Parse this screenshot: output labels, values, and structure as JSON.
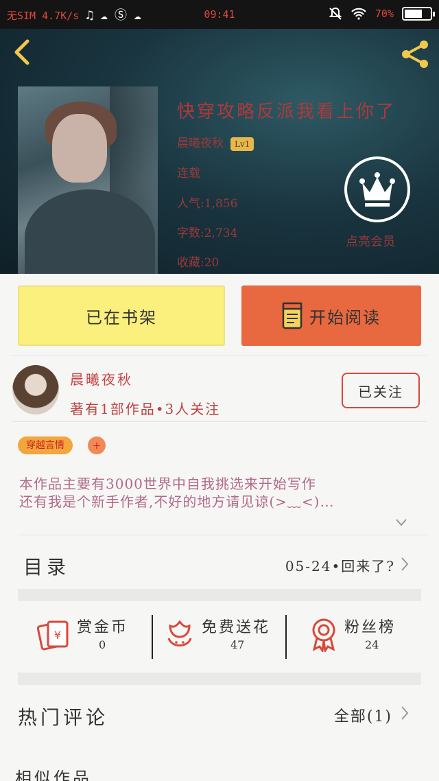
{
  "status_bar": {
    "carrier": "无SIM 4.7K/s",
    "time": "09:41",
    "battery": "70%",
    "battery_level": 0.7
  },
  "book": {
    "title": "快穿攻略反派我看上你了",
    "author": "晨曦夜秋",
    "level_badge": "Lv1",
    "status": "连载",
    "popularity": "人气:1,856",
    "word_count": "字数:2,734",
    "favorites": "收藏:20",
    "crown_label": "点亮会员"
  },
  "actions": {
    "shelf_label": "已在书架",
    "read_label": "开始阅读"
  },
  "author": {
    "name": "晨曦夜秋",
    "meta": "著有1部作品•3人关注",
    "follow_label": "已关注"
  },
  "tags": {
    "genre": "穿越言情",
    "add": "+"
  },
  "description": {
    "line1": "本作品主要有3000世界中自我挑选来开始写作",
    "line2": "还有我是个新手作者,不好的地方请见谅(>﹏<)…"
  },
  "catalog": {
    "title": "目录",
    "latest": "05-24•回来了?"
  },
  "stats": [
    {
      "label": "赏金币",
      "value": "0",
      "icon": "red-envelope-icon"
    },
    {
      "label": "免费送花",
      "value": "47",
      "icon": "flower-icon"
    },
    {
      "label": "粉丝榜",
      "value": "24",
      "icon": "ribbon-medal-icon"
    }
  ],
  "comments": {
    "title": "热门评论",
    "all_label": "全部(1)"
  },
  "similar": {
    "title": "相似作品"
  },
  "colors": {
    "accent_red": "#d8483a",
    "shelf_yellow": "#fbf07e",
    "read_orange": "#e8683f",
    "tag_orange": "#f2a63c"
  }
}
